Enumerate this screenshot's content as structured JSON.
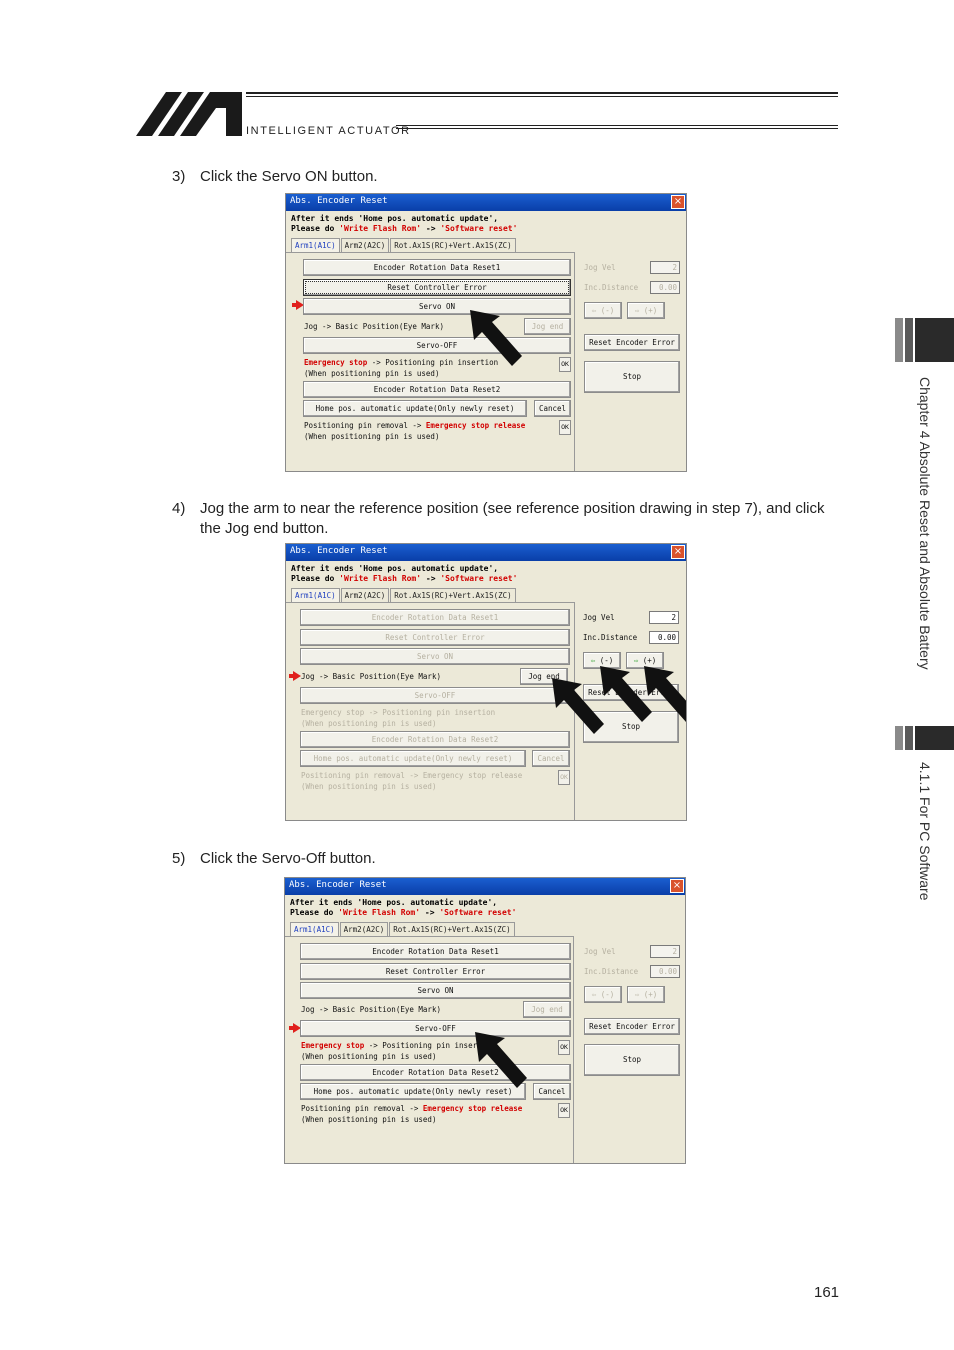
{
  "header": {
    "brand_text": "INTELLIGENT ACTUATOR"
  },
  "side": {
    "chapter_text": "Chapter 4 Absolute Reset and Absolute Battery",
    "section_text": "4.1.1 For PC Software"
  },
  "steps": [
    {
      "num": "3)",
      "text": "Click the Servo ON button."
    },
    {
      "num": "4)",
      "text": "Jog the arm to near the reference position (see reference position drawing in step 7), and click the Jog end button."
    },
    {
      "num": "5)",
      "text": "Click the Servo-Off button."
    }
  ],
  "dialog": {
    "title": "Abs. Encoder Reset",
    "close": "×",
    "msg1_prefix": "After it ends 'Home pos. automatic update',",
    "msg2_a": "Please do ",
    "msg2_b": "'Write Flash Rom'",
    "msg2_c": " -> ",
    "msg2_d": "'Software reset'",
    "tabs": [
      "Arm1(A1C)",
      "Arm2(A2C)",
      "Rot.Ax1S(RC)+Vert.Ax1S(ZC)"
    ],
    "encoder_rotation_reset1": "Encoder Rotation Data Reset1",
    "reset_controller_error": "Reset Controller Error",
    "servo_on": "Servo ON",
    "jog_basic_position": "Jog -> Basic Position(Eye Mark)",
    "jog_end": "Jog end",
    "servo_off": "Servo-OFF",
    "emergency_stop": "Emergency stop",
    "positioning_pin_insertion": " -> Positioning pin insertion",
    "when_pin_used": "(When positioning pin is used)",
    "ok": "OK",
    "encoder_rotation_reset2": "Encoder Rotation Data Reset2",
    "home_pos_update": "Home pos. automatic update(Only newly reset)",
    "cancel": "Cancel",
    "pin_removal": "Positioning pin removal -> ",
    "emergency_stop_release": "Emergency stop release",
    "jog_vel_label": "Jog Vel",
    "jog_vel_value": "2",
    "inc_distance_label": "Inc.Distance",
    "inc_distance_value": "0.00",
    "jog_minus": "(-)",
    "jog_plus": "(+)",
    "reset_encoder_error": "Reset Encoder Error",
    "stop": "Stop"
  },
  "page": {
    "number": "161"
  },
  "colors": {
    "title_bar": "#0a3ea8",
    "dialog_bg": "#ece9d8",
    "highlight_red": "#d20000",
    "side_tab_dark": "#2a2a2a"
  }
}
